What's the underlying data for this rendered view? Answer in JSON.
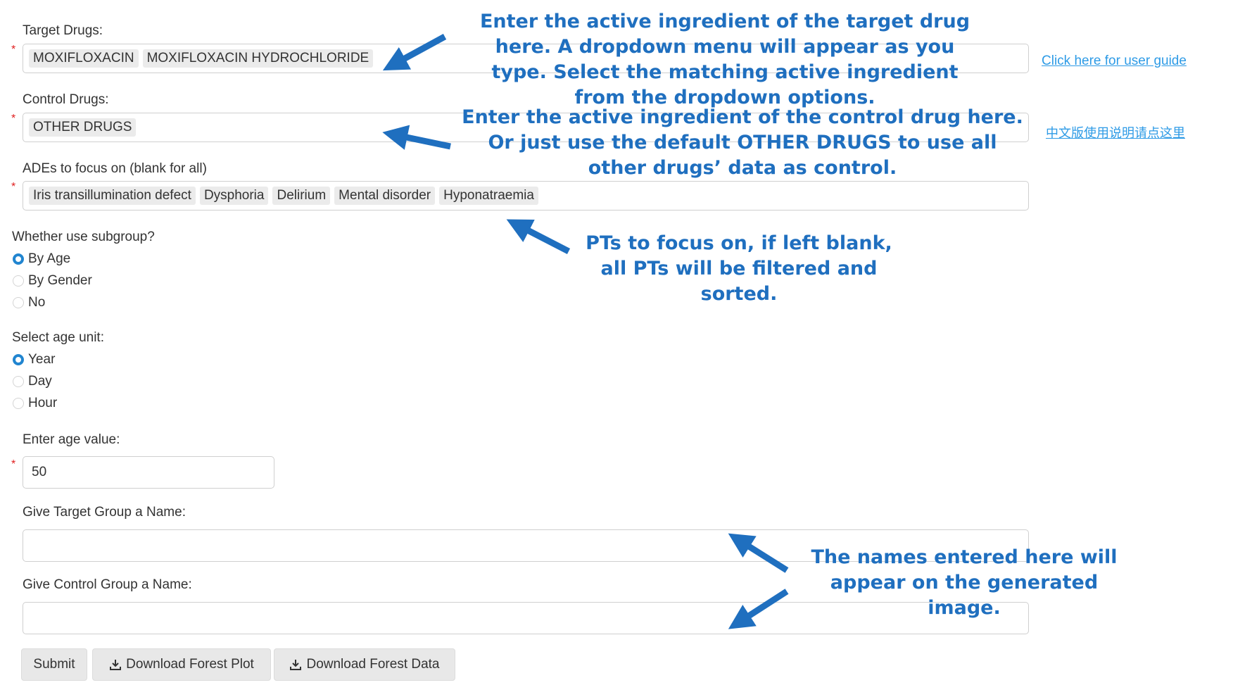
{
  "form": {
    "target_drugs": {
      "label": "Target Drugs:",
      "tags": [
        "MOXIFLOXACIN",
        "MOXIFLOXACIN HYDROCHLORIDE"
      ]
    },
    "control_drugs": {
      "label": "Control Drugs:",
      "tags": [
        "OTHER DRUGS"
      ]
    },
    "ades": {
      "label": "ADEs to focus on (blank for all)",
      "tags": [
        "Iris transillumination defect",
        "Dysphoria",
        "Delirium",
        "Mental disorder",
        "Hyponatraemia"
      ]
    },
    "subgroup": {
      "label": "Whether use subgroup?",
      "options": [
        "By Age",
        "By Gender",
        "No"
      ],
      "selected": "By Age"
    },
    "age_unit": {
      "label": "Select age unit:",
      "options": [
        "Year",
        "Day",
        "Hour"
      ],
      "selected": "Year"
    },
    "age_value": {
      "label": "Enter age value:",
      "value": "50"
    },
    "target_group_name": {
      "label": "Give Target Group a Name:",
      "value": ""
    },
    "control_group_name": {
      "label": "Give Control Group a Name:",
      "value": ""
    },
    "required_mark": "*"
  },
  "buttons": {
    "submit": "Submit",
    "download_plot": "Download Forest Plot",
    "download_data": "Download Forest Data"
  },
  "links": {
    "user_guide": "Click here for user guide",
    "chinese_guide": "中文版使用说明请点这里"
  },
  "annotations": {
    "target": "Enter the active ingredient of the target drug here. A dropdown menu will appear as you type. Select the matching active ingredient from the dropdown options.",
    "control": "Enter the active ingredient of the control drug here. Or just use the default OTHER DRUGS to use all other drugs’ data as control.",
    "pts": "PTs to focus on, if left blank, all PTs will be filtered and sorted.",
    "names": "The names entered here will appear on the generated image."
  },
  "colors": {
    "annotation": "#1f6fbf",
    "required": "#e02020",
    "radio_selected": "#2185d0",
    "link": "#2e9be6"
  }
}
